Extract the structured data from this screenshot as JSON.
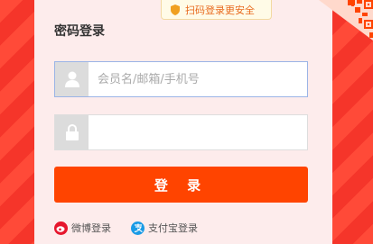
{
  "colors": {
    "accent": "#ff4400",
    "background": "#ff3b2f",
    "card": "#fdecec"
  },
  "qr_hint": {
    "text": "扫码登录更安全",
    "icon": "shield-icon"
  },
  "qr_corner": {
    "icon": "qr-code-icon"
  },
  "login": {
    "title": "密码登录",
    "username": {
      "value": "",
      "placeholder": "会员名/邮箱/手机号",
      "icon": "user-icon"
    },
    "password": {
      "value": "",
      "placeholder": "",
      "icon": "lock-icon"
    },
    "submit_label": "登 录"
  },
  "other_logins": [
    {
      "label": "微博登录",
      "icon": "weibo-icon"
    },
    {
      "label": "支付宝登录",
      "icon": "alipay-icon"
    }
  ]
}
